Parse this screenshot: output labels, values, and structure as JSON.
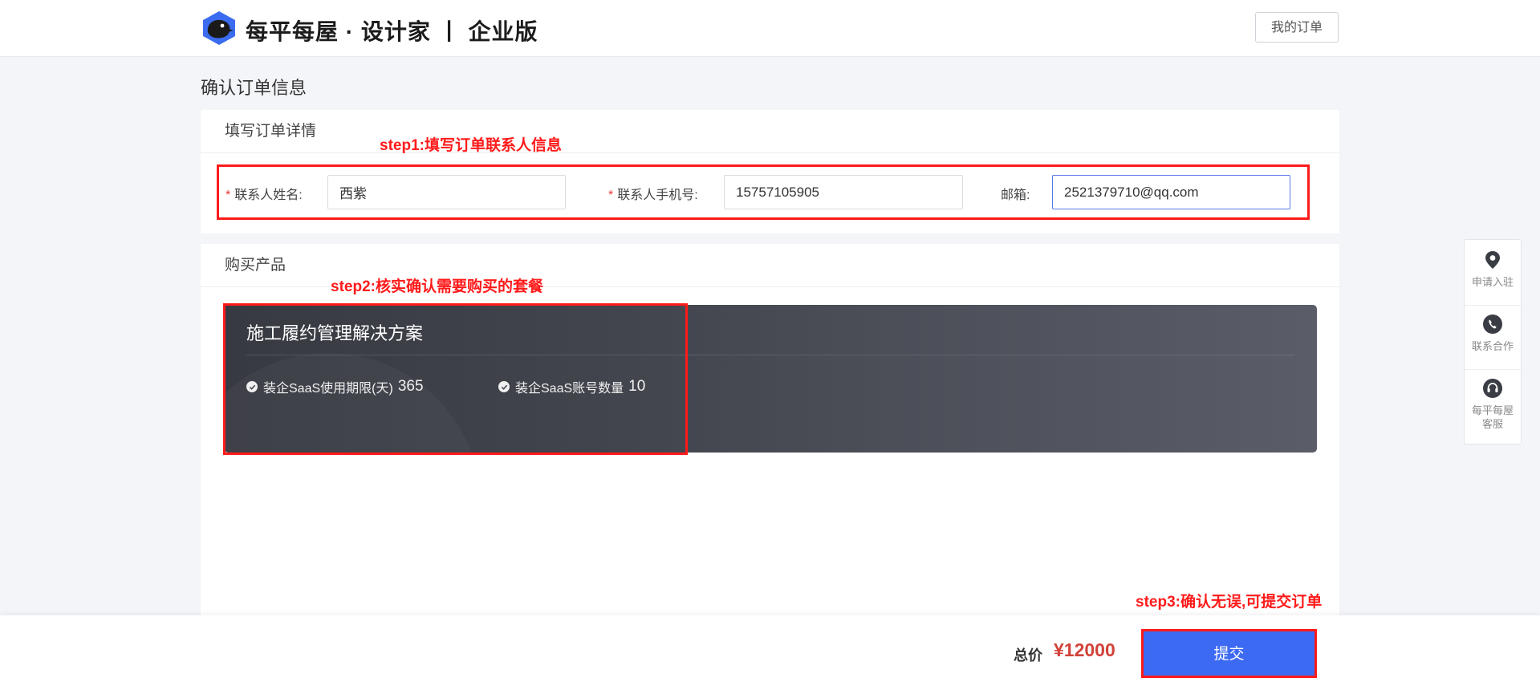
{
  "header": {
    "brand": "每平每屋 · 设计家 丨 企业版",
    "my_orders_label": "我的订单"
  },
  "page": {
    "title": "确认订单信息"
  },
  "order_details": {
    "section_title": "填写订单详情",
    "contact_name": {
      "label": "联系人姓名:",
      "required": true,
      "value": "西紫"
    },
    "contact_phone": {
      "label": "联系人手机号:",
      "required": true,
      "value": "15757105905"
    },
    "email": {
      "label": "邮箱:",
      "required": false,
      "value": "2521379710@qq.com"
    }
  },
  "purchase": {
    "section_title": "购买产品",
    "product_name": "施工履约管理解决方案",
    "features": [
      {
        "label": "装企SaaS使用期限(天)",
        "value": "365"
      },
      {
        "label": "装企SaaS账号数量",
        "value": "10"
      }
    ]
  },
  "annotations": {
    "step1": "step1:填写订单联系人信息",
    "step2": "step2:核实确认需要购买的套餐",
    "step3": "step3:确认无误,可提交订单",
    "color": "#ff1a1a"
  },
  "side_panel": {
    "items": [
      {
        "label": "申请入驻",
        "icon": "location-pin-icon"
      },
      {
        "label": "联系合作",
        "icon": "phone-icon"
      },
      {
        "label": "每平每屋\n客服",
        "label_line1": "每平每屋",
        "label_line2": "客服",
        "icon": "headset-icon"
      }
    ]
  },
  "footer": {
    "total_label": "总价",
    "total_value": "¥12000",
    "submit_label": "提交"
  },
  "colors": {
    "primary": "#3d6af2",
    "price": "#d1423a",
    "required": "#e53935"
  }
}
